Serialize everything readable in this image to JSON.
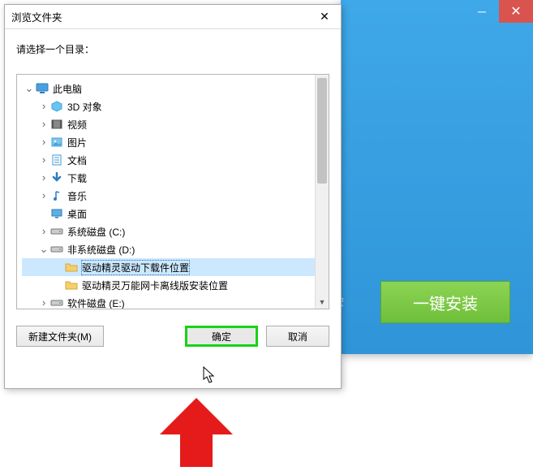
{
  "bg": {
    "install_label": "一键安装",
    "small_text": "安"
  },
  "dialog": {
    "title": "浏览文件夹",
    "prompt": "请选择一个目录：",
    "buttons": {
      "new_folder": "新建文件夹(M)",
      "ok": "确定",
      "cancel": "取消"
    }
  },
  "tree": {
    "root": {
      "label": "此电脑",
      "expanded": true
    },
    "items": [
      {
        "icon": "3d",
        "label": "3D 对象"
      },
      {
        "icon": "vid",
        "label": "视频"
      },
      {
        "icon": "img",
        "label": "图片"
      },
      {
        "icon": "doc",
        "label": "文档"
      },
      {
        "icon": "dl",
        "label": "下载"
      },
      {
        "icon": "mus",
        "label": "音乐"
      },
      {
        "icon": "desk",
        "label": "桌面"
      },
      {
        "icon": "disk",
        "label": "系统磁盘 (C:)"
      }
    ],
    "drive_d": {
      "label": "非系统磁盘 (D:)",
      "expanded": true,
      "children": [
        {
          "label": "驱动精灵驱动下载件位置",
          "selected": true
        },
        {
          "label": "驱动精灵万能网卡离线版安装位置"
        }
      ]
    },
    "drive_e": {
      "label": "软件磁盘 (E:)"
    }
  }
}
